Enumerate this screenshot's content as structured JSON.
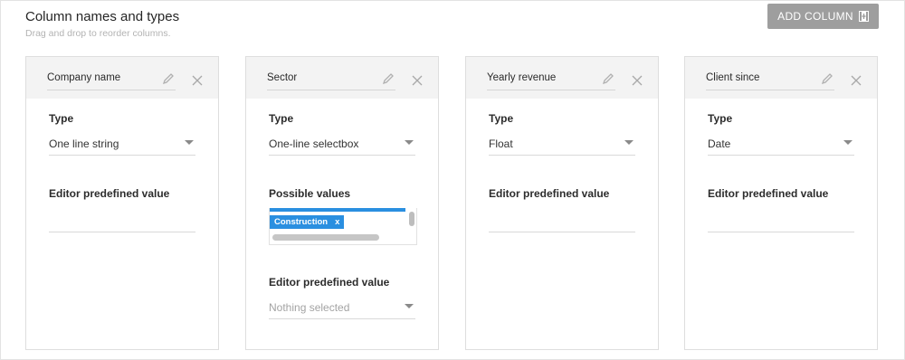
{
  "header": {
    "title": "Column names and types",
    "subtitle": "Drag and drop to reorder columns.",
    "add_button_label": "ADD COLUMN"
  },
  "labels": {
    "type": "Type",
    "editor_predefined_value": "Editor predefined value",
    "possible_values": "Possible values"
  },
  "columns": [
    {
      "name": "Company name",
      "type": "One line string",
      "editor_value": ""
    },
    {
      "name": "Sector",
      "type": "One-line selectbox",
      "possible_values": [
        "Construction"
      ],
      "tag_remove": "x",
      "editor_value": "Nothing selected"
    },
    {
      "name": "Yearly revenue",
      "type": "Float",
      "editor_value": ""
    },
    {
      "name": "Client since",
      "type": "Date",
      "editor_value": ""
    }
  ],
  "colors": {
    "accent": "#2a8fe0",
    "button_bg": "#9e9e9e",
    "card_header_bg": "#f3f3f3"
  },
  "icons": {
    "edit": "pencil-icon",
    "remove": "close-icon",
    "add": "add-column-icon",
    "dropdown": "chevron-down-icon"
  }
}
